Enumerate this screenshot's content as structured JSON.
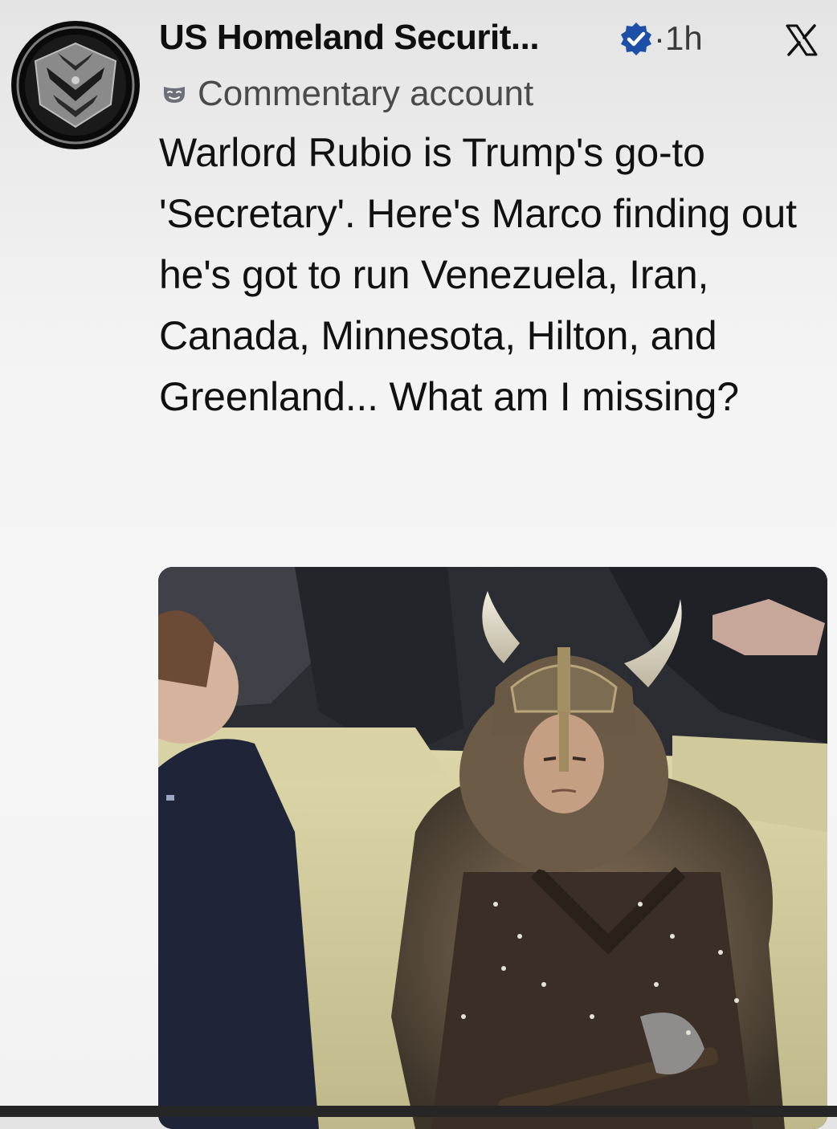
{
  "post": {
    "author_name": "US Homeland Securit...",
    "verified": true,
    "separator": "·",
    "time": "1h",
    "account_label": "Commentary account",
    "text": "Warlord Rubio is Trump's go-to 'Secretary'. Here's Marco finding out he's got to run Venezuela, Iran, Canada, Minnesota, Hilton, and Greenland... What am I missing?"
  },
  "icons": {
    "avatar": "shield-eagle-logo",
    "verified": "verified-badge-icon",
    "platform": "x-logo-icon",
    "account_type": "mask-icon",
    "media": "photo-viking-helmet-man-on-couch"
  },
  "colors": {
    "verified_blue": "#1d9bf0",
    "text": "#111111",
    "secondary_text": "#4a4a4a"
  }
}
